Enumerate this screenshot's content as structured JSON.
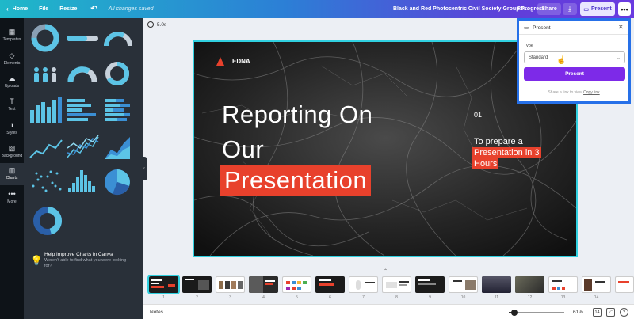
{
  "topbar": {
    "home": "Home",
    "file": "File",
    "resize": "Resize",
    "saved_status": "All changes saved",
    "doc_title": "Black and Red Photocentric Civil Society Group Progress",
    "doc_title_tail": "Re...",
    "share": "Share",
    "present": "Present",
    "more": "•••",
    "icons": [
      "chevron-left-icon",
      "undo-icon",
      "download-icon",
      "present-icon"
    ]
  },
  "rail": {
    "items": [
      {
        "label": "Templates",
        "icon": "▦"
      },
      {
        "label": "Elements",
        "icon": "◇"
      },
      {
        "label": "Uploads",
        "icon": "☁"
      },
      {
        "label": "Text",
        "icon": "T"
      },
      {
        "label": "Styles",
        "icon": "◑"
      },
      {
        "label": "Background",
        "icon": "▨"
      },
      {
        "label": "Charts",
        "icon": "▥"
      },
      {
        "label": "More",
        "icon": "•••"
      }
    ],
    "active": "Charts"
  },
  "charts_panel": {
    "help_title": "Help improve Charts in Canva",
    "help_body_1": "Weren't able to find what you were looking",
    "help_body_2": "for?",
    "chart_colors": [
      "#5cc4e6",
      "#3b8fd4",
      "#2a5fa8",
      "#8ed8f0"
    ]
  },
  "canvas": {
    "duration": "5.0s"
  },
  "slide": {
    "brand": "EDNA",
    "title_line1": "Reporting On",
    "title_line2": "Our",
    "title_line3": "Presentation",
    "number": "01",
    "sub_line1": "To prepare a",
    "sub_line2": "Presentation in 3",
    "sub_line3": "Hours",
    "accent": "#e8412c"
  },
  "present_popup": {
    "title": "Present",
    "type_label": "Type",
    "type_value": "Standard",
    "button": "Present",
    "share_text": "Share a link to view",
    "copy_link": "Copy link"
  },
  "filmstrip": {
    "collapse_label": "⌃",
    "pages": [
      "1",
      "2",
      "3",
      "4",
      "5",
      "6",
      "7",
      "8",
      "9",
      "10",
      "11",
      "12",
      "13",
      "14"
    ]
  },
  "bottombar": {
    "notes": "Notes",
    "zoom": "61%",
    "zoom_fraction": 0.1,
    "pages_button": "14",
    "fullscreen_icon": "⤢",
    "help": "?"
  }
}
